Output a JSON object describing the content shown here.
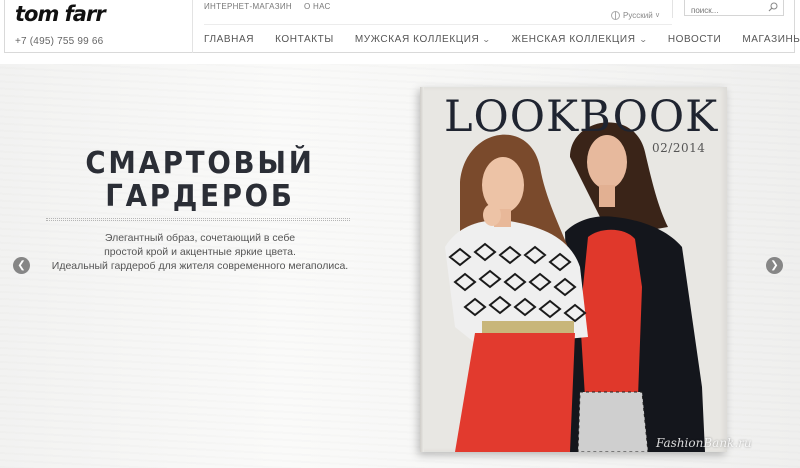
{
  "header": {
    "logo": "tom farr",
    "phone": "+7 (495) 755 99 66",
    "top_links": [
      "ИНТЕРНЕТ-МАГАЗИН",
      "О НАС"
    ],
    "language": "Русский",
    "search_placeholder": "поиск...",
    "main_nav": [
      {
        "label": "ГЛАВНАЯ",
        "dropdown": false
      },
      {
        "label": "КОНТАКТЫ",
        "dropdown": false
      },
      {
        "label": "МУЖСКАЯ КОЛЛЕКЦИЯ",
        "dropdown": true
      },
      {
        "label": "ЖЕНСКАЯ КОЛЛЕКЦИЯ",
        "dropdown": true
      },
      {
        "label": "НОВОСТИ",
        "dropdown": false
      },
      {
        "label": "МАГАЗИНЫ",
        "dropdown": false
      }
    ]
  },
  "hero": {
    "title_line1": "СМАРТОВЫЙ",
    "title_line2": "ГАРДЕРОБ",
    "desc_line1": "Элегантный образ, сочетающий в себе",
    "desc_line2": "простой крой и акцентные яркие цвета.",
    "desc_line3": "Идеальный гардероб для жителя современного мегаполиса.",
    "cover_title": "LOOKBOOK",
    "cover_issue": "02/2014",
    "watermark": "FashionBank.ru"
  },
  "icons": {
    "prev": "chevron-left-icon",
    "next": "chevron-right-icon",
    "search": "search-icon",
    "language": "globe-icon"
  },
  "colors": {
    "title": "#2b2e36",
    "accent_red": "#e0382b",
    "jacket": "#14161c"
  }
}
